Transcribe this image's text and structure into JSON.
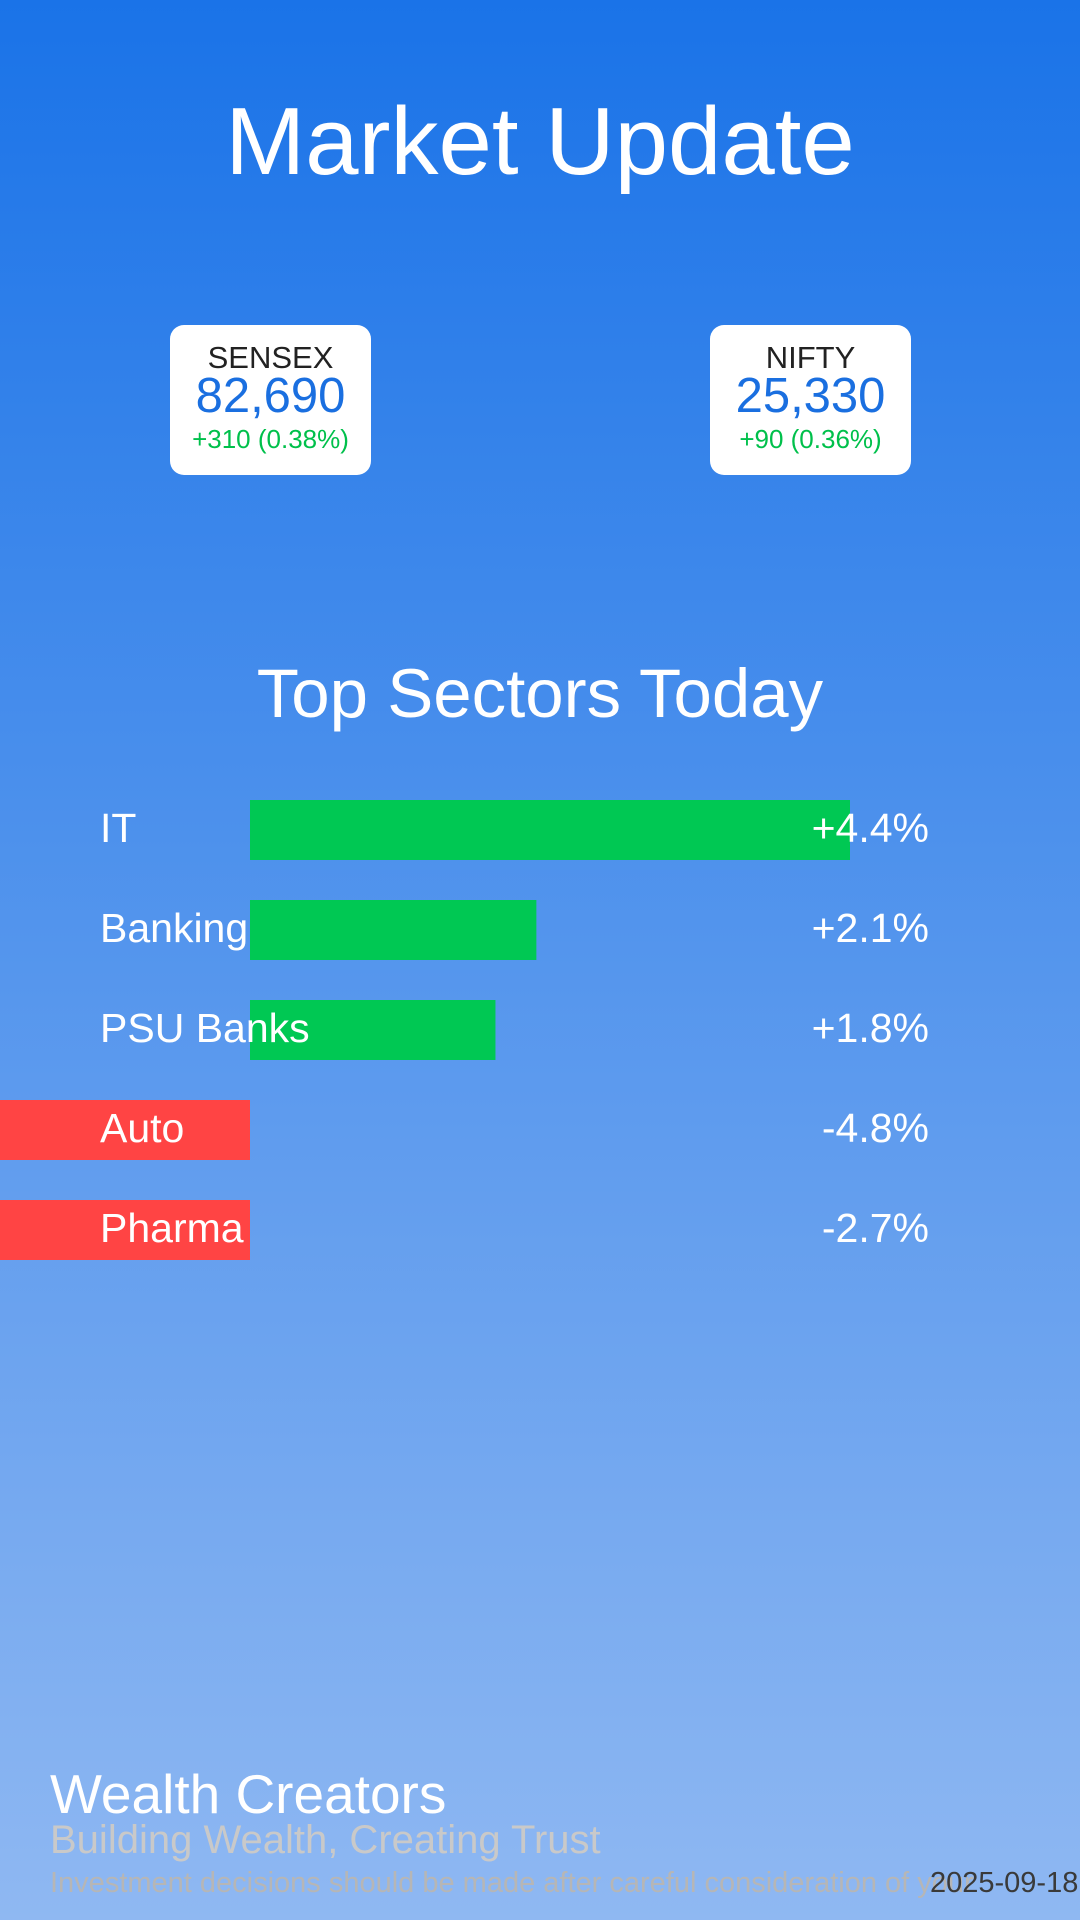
{
  "colors": {
    "background_top": "#1a73e8",
    "background_bottom": "#8fb8f2",
    "positive": "#00c853",
    "negative": "#ff4444",
    "index_value": "#1a6fe0",
    "text": "#ffffff"
  },
  "header": {
    "title": "Market Update"
  },
  "indices": [
    {
      "name": "SENSEX",
      "value": "82,690",
      "change": "+310 (0.38%)"
    },
    {
      "name": "NIFTY",
      "value": "25,330",
      "change": "+90 (0.36%)"
    }
  ],
  "chart_data": {
    "type": "bar",
    "title": "Top Sectors Today",
    "categories": [
      "IT",
      "Banking",
      "PSU Banks",
      "Auto",
      "Pharma"
    ],
    "values": [
      4.4,
      2.1,
      1.8,
      -4.8,
      -2.7
    ],
    "value_labels": [
      "+4.4%",
      "+2.1%",
      "+1.8%",
      "-4.8%",
      "-2.7%"
    ],
    "orientation": "horizontal",
    "grid": false
  },
  "footer": {
    "brand": "Wealth Creators",
    "tagline": "Building Wealth, Creating Trust",
    "disclaimer": "Investment decisions should be made after careful consideration of your",
    "date": "2025-09-18"
  }
}
